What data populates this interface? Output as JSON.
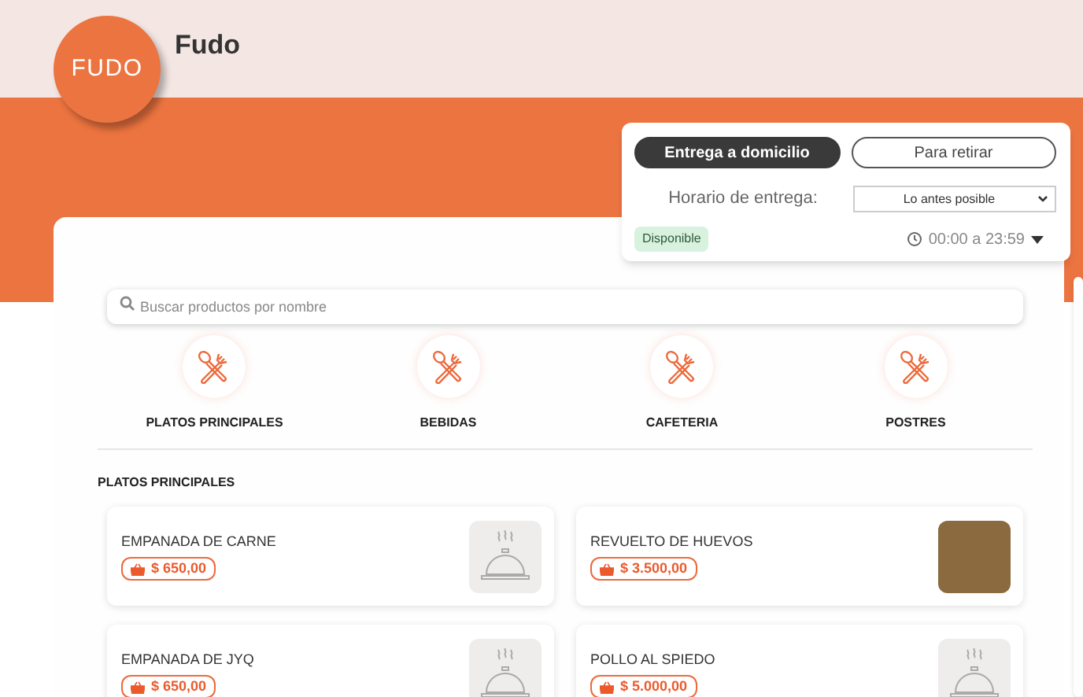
{
  "store": {
    "name": "Fudo",
    "logo": "FUDO"
  },
  "delivery": {
    "modes": [
      {
        "label": "Entrega a domicilio",
        "selected": true
      },
      {
        "label": "Para retirar",
        "selected": false
      }
    ],
    "schedule_label": "Horario de entrega:",
    "schedule_value": "Lo antes posible",
    "status": "Disponible",
    "hours": "00:00 a 23:59"
  },
  "search": {
    "placeholder": "Buscar productos por nombre"
  },
  "categories": [
    {
      "label": "PLATOS PRINCIPALES"
    },
    {
      "label": "BEBIDAS"
    },
    {
      "label": "CAFETERIA"
    },
    {
      "label": "POSTRES"
    }
  ],
  "section": {
    "title": "PLATOS PRINCIPALES",
    "products": [
      {
        "name": "EMPANADA DE CARNE",
        "price": "$ 650,00",
        "kind": "placeholder"
      },
      {
        "name": "REVUELTO DE HUEVOS",
        "price": "$ 3.500,00",
        "kind": "photo"
      },
      {
        "name": "EMPANADA DE JYQ",
        "price": "$ 650,00",
        "kind": "placeholder"
      },
      {
        "name": "POLLO AL SPIEDO",
        "price": "$ 5.000,00",
        "kind": "placeholder"
      }
    ]
  }
}
